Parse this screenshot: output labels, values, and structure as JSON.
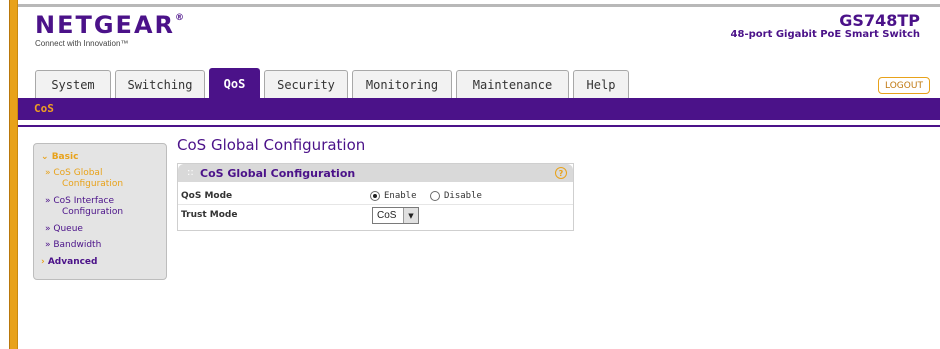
{
  "brand": {
    "logo": "NETGEAR",
    "tagline": "Connect with Innovation™",
    "model": "GS748TP",
    "model_description": "48-port Gigabit PoE Smart Switch"
  },
  "tabs": [
    {
      "label": "System",
      "active": false
    },
    {
      "label": "Switching",
      "active": false
    },
    {
      "label": "QoS",
      "active": true
    },
    {
      "label": "Security",
      "active": false
    },
    {
      "label": "Monitoring",
      "active": false
    },
    {
      "label": "Maintenance",
      "active": false
    },
    {
      "label": "Help",
      "active": false
    }
  ],
  "logout_label": "LOGOUT",
  "subnav": {
    "current": "CoS"
  },
  "sidebar": {
    "basic_label": "Basic",
    "items": [
      {
        "line1": "» CoS Global",
        "line2": "Configuration",
        "active": true
      },
      {
        "line1": "» CoS Interface",
        "line2": "Configuration",
        "active": false
      },
      {
        "line1": "» Queue",
        "active": false
      },
      {
        "line1": "» Bandwidth",
        "active": false
      }
    ],
    "advanced_label": "Advanced"
  },
  "page_title": "CoS Global Configuration",
  "panel": {
    "title": "CoS Global Configuration",
    "dots": "::",
    "help_icon": "?",
    "qos_mode": {
      "label": "QoS Mode",
      "options": [
        "Enable",
        "Disable"
      ],
      "selected": "Enable"
    },
    "trust_mode": {
      "label": "Trust Mode",
      "value": "CoS"
    }
  },
  "colors": {
    "brand_purple": "#4b1289",
    "accent_orange": "#e8a21a"
  }
}
